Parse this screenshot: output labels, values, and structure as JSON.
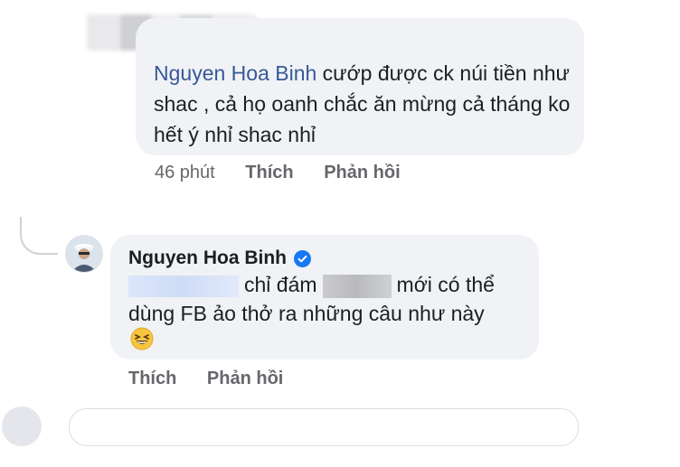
{
  "comment1": {
    "mention": "Nguyen Hoa Binh",
    "text": " cướp được ck núi tiền như shac , cả họ oanh chắc ăn mừng cả tháng ko hết ý nhỉ shac nhỉ",
    "time": "46 phút",
    "like_label": "Thích",
    "reply_label": "Phản hồi"
  },
  "comment2": {
    "author": "Nguyen Hoa Binh",
    "line1_mid": "chỉ đám",
    "line1_end": "mới có thể",
    "line2": "dùng FB ảo thở ra những câu như này",
    "emoji": "laughing-squint-emoji",
    "like_label": "Thích",
    "reply_label": "Phản hồi"
  },
  "colors": {
    "bubble": "#f0f2f5",
    "mention": "#385898",
    "meta": "#65676b",
    "verified": "#1877f2"
  }
}
